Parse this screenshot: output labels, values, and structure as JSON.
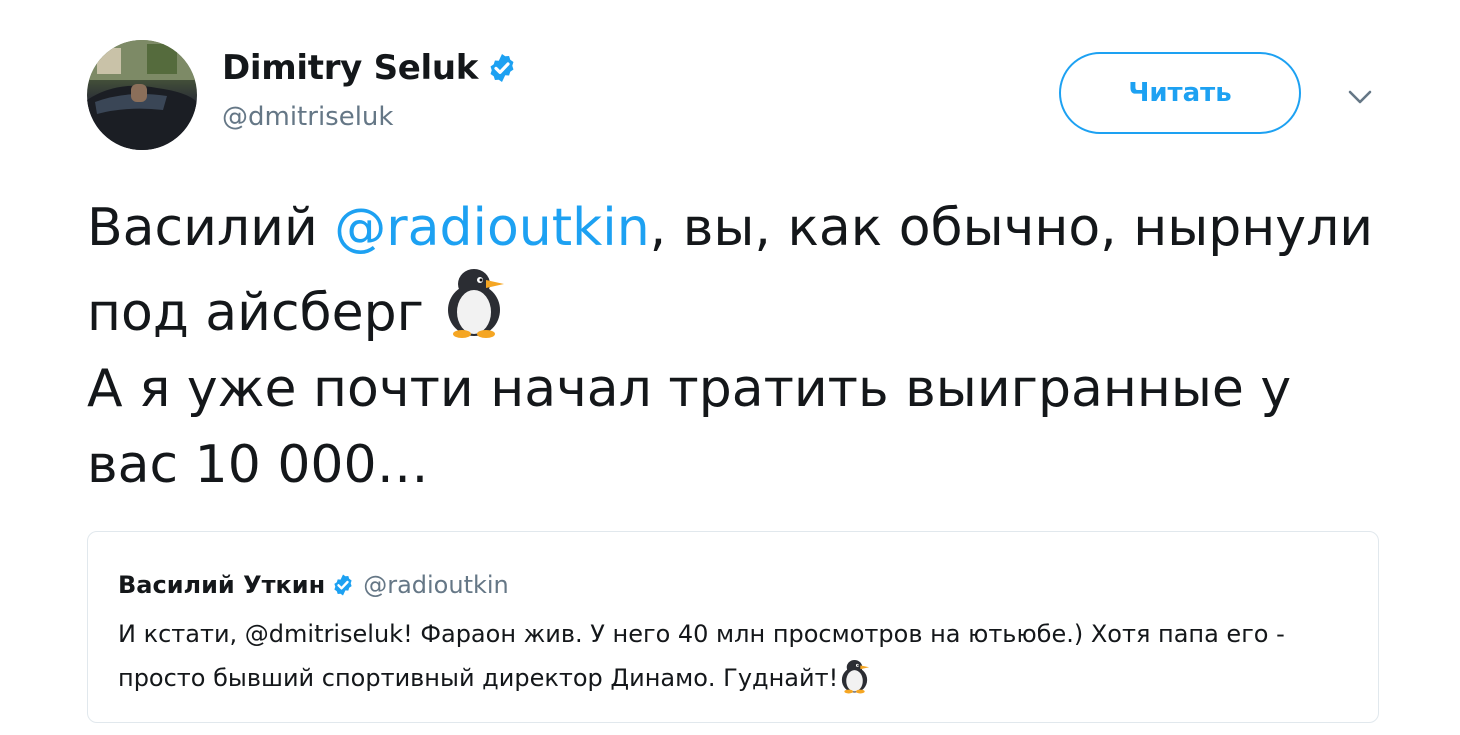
{
  "author": {
    "name": "Dimitry Seluk",
    "handle": "@dmitriseluk",
    "verified_icon": "verified-badge",
    "avatar_icon": "profile-photo-car"
  },
  "actions": {
    "follow_label": "Читать",
    "more_icon": "chevron-down"
  },
  "tweet": {
    "part1": "Василий ",
    "mention": "@radioutkin",
    "part2": ", вы, как обычно, нырнули под айсберг ",
    "emoji_icon": "penguin",
    "line2": "А я уже почти начал тратить выигранные у вас 10 000…"
  },
  "quoted": {
    "name": "Василий Уткин",
    "handle": "@radioutkin",
    "text": "И кстати, @dmitriseluk! Фараон жив. У него 40 млн просмотров на ютьюбе.) Хотя папа его - просто бывший спортивный директор Динамо. Гуднайт!",
    "emoji_icon": "penguin"
  },
  "colors": {
    "accent": "#1da1f2",
    "text": "#14171a",
    "secondary": "#657786",
    "border": "#e1e8ed"
  }
}
